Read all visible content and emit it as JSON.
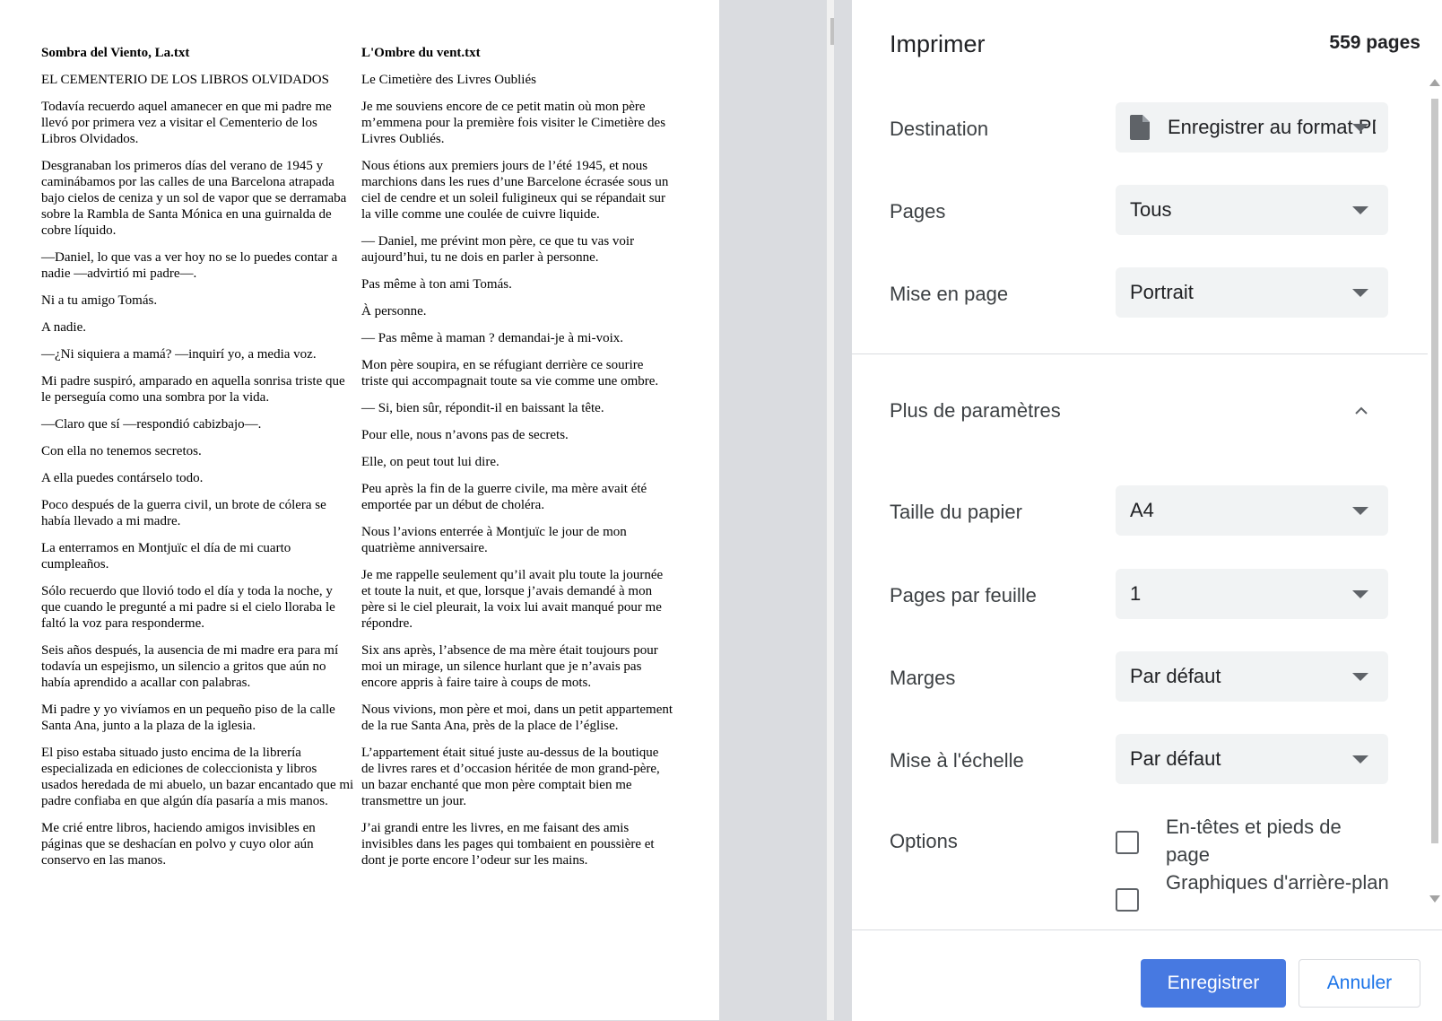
{
  "preview": {
    "left_column": {
      "title": "Sombra del Viento, La.txt",
      "paragraphs": [
        "EL CEMENTERIO DE LOS LIBROS OLVIDADOS",
        "Todavía recuerdo aquel amanecer en que mi padre me llevó por primera vez a visitar el Cementerio de los Libros Olvidados.",
        "Desgranaban los primeros días del verano de 1945 y caminábamos por las calles de una Barcelona atrapada bajo cielos de ceniza y un sol de vapor que se derramaba sobre la Rambla de Santa Mónica en una guirnalda de cobre líquido.",
        "—Daniel, lo que vas a ver hoy no se lo puedes contar a nadie —advirtió mi padre—.",
        "Ni a tu amigo Tomás.",
        "A nadie.",
        "—¿Ni siquiera a mamá? —inquirí yo, a media voz.",
        "Mi padre suspiró, amparado en aquella sonrisa triste que le perseguía como una sombra por la vida.",
        "—Claro que sí —respondió cabizbajo—.",
        "Con ella no tenemos secretos.",
        "A ella puedes contárselo todo.",
        "Poco después de la guerra civil, un brote de cólera se había llevado a mi madre.",
        "La enterramos en Montjuïc el día de mi cuarto cumpleaños.",
        "Sólo recuerdo que llovió todo el día y toda la noche, y que cuando le pregunté a mi padre si el cielo lloraba le faltó la voz para responderme.",
        "Seis años después, la ausencia de mi madre era para mí todavía un espejismo, un silencio a gritos que aún no había aprendido a acallar con palabras.",
        "Mi padre y yo vivíamos en un pequeño piso de la calle Santa Ana, junto a la plaza de la iglesia.",
        "El piso estaba situado justo encima de la librería especializada en ediciones de coleccionista y libros usados heredada de mi abuelo, un bazar encantado que mi padre confiaba en que algún día pasaría a mis manos.",
        "Me crié entre libros, haciendo amigos invisibles en páginas que se deshacían en polvo y cuyo olor aún conservo en las manos."
      ]
    },
    "right_column": {
      "title": "L'Ombre du vent.txt",
      "paragraphs": [
        "Le Cimetière des Livres Oubliés",
        "Je me souviens encore de ce petit matin où mon père m’emmena pour la première fois visiter le Cimetière des Livres Oubliés.",
        "Nous étions aux premiers jours de l’été 1945, et nous marchions dans les rues d’une Barcelone écrasée sous un ciel de cendre et un soleil fuligineux qui se répandait sur la ville comme une coulée de cuivre liquide.",
        "— Daniel, me prévint mon père, ce que tu vas voir aujourd’hui, tu ne dois en parler à personne.",
        "Pas même à ton ami Tomás.",
        "À personne.",
        "— Pas même à maman ? demandai-je à mi-voix.",
        "Mon père soupira, en se réfugiant derrière ce sourire triste qui accompagnait toute sa vie comme une ombre.",
        "— Si, bien sûr, répondit-il en baissant la tête.",
        "Pour elle, nous n’avons pas de secrets.",
        "Elle, on peut tout lui dire.",
        "Peu après la fin de la guerre civile, ma mère avait été emportée par un début de choléra.",
        "Nous l’avions enterrée à Montjuïc le jour de mon quatrième anniversaire.",
        "Je me rappelle seulement qu’il avait plu toute la journée et toute la nuit, et que, lorsque j’avais demandé à mon père si le ciel pleurait, la voix lui avait manqué pour me répondre.",
        "Six ans après, l’absence de ma mère était toujours pour moi un mirage, un silence hurlant que je n’avais pas encore appris à faire taire à coups de mots.",
        "Nous vivions, mon père et moi, dans un petit appartement de la rue Santa Ana, près de la place de l’église.",
        "L’appartement était situé juste au-dessus de la boutique de livres rares et d’occasion héritée de mon grand-père, un bazar enchanté que mon père comptait bien me transmettre un jour.",
        "J’ai grandi entre les livres, en me faisant des amis invisibles dans les pages qui tombaient en poussière et dont je porte encore l’odeur sur les mains."
      ]
    }
  },
  "panel": {
    "title": "Imprimer",
    "page_count": "559 pages",
    "settings": [
      {
        "key": "destination",
        "label": "Destination",
        "value": "Enregistrer au format PDF",
        "icon": "file-icon"
      },
      {
        "key": "pages",
        "label": "Pages",
        "value": "Tous"
      },
      {
        "key": "layout",
        "label": "Mise en page",
        "value": "Portrait"
      }
    ],
    "more_settings_label": "Plus de paramètres",
    "more_settings": [
      {
        "key": "paper-size",
        "label": "Taille du papier",
        "value": "A4"
      },
      {
        "key": "pages-per-sheet",
        "label": "Pages par feuille",
        "value": "1"
      },
      {
        "key": "margins",
        "label": "Marges",
        "value": "Par défaut"
      },
      {
        "key": "scale",
        "label": "Mise à l'échelle",
        "value": "Par défaut"
      }
    ],
    "options_label": "Options",
    "options": [
      {
        "label": "En-têtes et pieds de page",
        "checked": false
      },
      {
        "label": "Graphiques d'arrière-plan",
        "checked": false
      }
    ],
    "save_label": "Enregistrer",
    "cancel_label": "Annuler",
    "colors": {
      "primary": "#4779e1",
      "link": "#1a73e8",
      "select_bg": "#f1f3f4"
    }
  }
}
